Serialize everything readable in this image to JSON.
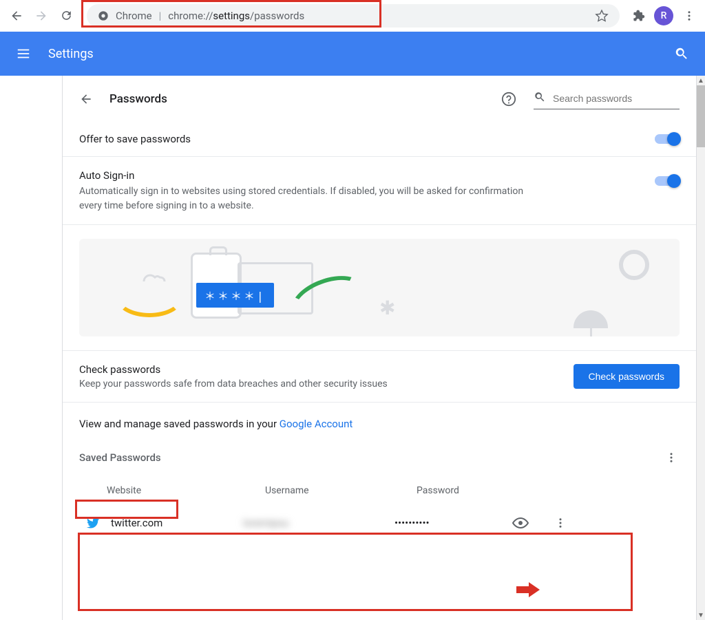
{
  "browser": {
    "chrome_label": "Chrome",
    "separator": "|",
    "url_prefix": "chrome://",
    "url_bold": "settings",
    "url_suffix": "/passwords",
    "avatar_letter": "R"
  },
  "header": {
    "title": "Settings"
  },
  "page": {
    "title": "Passwords",
    "search_placeholder": "Search passwords"
  },
  "toggles": {
    "offer_to_save": {
      "label": "Offer to save passwords"
    },
    "auto_signin": {
      "label": "Auto Sign-in",
      "sub": "Automatically sign in to websites using stored credentials. If disabled, you will be asked for confirmation every time before signing in to a website."
    }
  },
  "banner": {
    "pw_chip": "＊＊＊＊|"
  },
  "check": {
    "title": "Check passwords",
    "sub": "Keep your passwords safe from data breaches and other security issues",
    "button": "Check passwords"
  },
  "view_manage": {
    "prefix": "View and manage saved passwords in your ",
    "link": "Google Account"
  },
  "saved": {
    "heading": "Saved Passwords",
    "columns": {
      "website": "Website",
      "username": "Username",
      "password": "Password"
    },
    "rows": [
      {
        "site": "twitter.com",
        "username": "loremipsu",
        "password_mask": "••••••••••"
      }
    ]
  }
}
